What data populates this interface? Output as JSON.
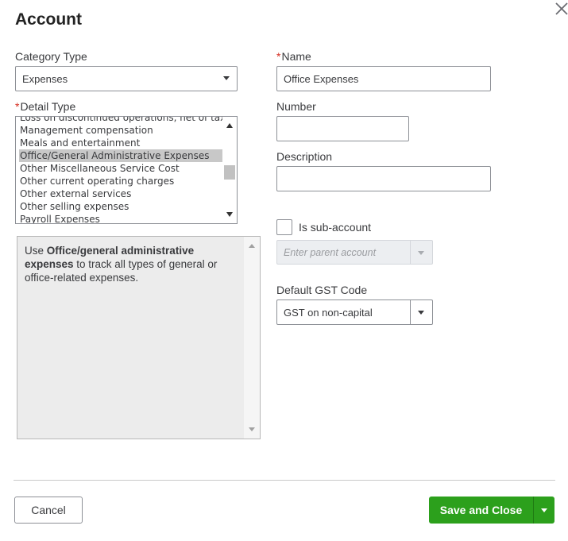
{
  "dialog": {
    "title": "Account"
  },
  "left": {
    "category_type_label": "Category Type",
    "category_type_value": "Expenses",
    "detail_type_label": "Detail Type",
    "detail_type_items": [
      "Loss on discontinued operations, net of tax",
      "Management compensation",
      "Meals and entertainment",
      "Office/General Administrative Expenses",
      "Other Miscellaneous Service Cost",
      "Other current operating charges",
      "Other external services",
      "Other selling expenses",
      "Payroll Expenses"
    ],
    "detail_type_selected": "Office/General Administrative Expenses",
    "description": {
      "prefix": "Use ",
      "bold": "Office/general administrative expenses",
      "suffix": " to track all types of general or office-related expenses."
    }
  },
  "right": {
    "name_label": "Name",
    "name_value": "Office Expenses",
    "number_label": "Number",
    "number_value": "",
    "description_label": "Description",
    "description_value": "",
    "subaccount_label": "Is sub-account",
    "subaccount_checked": false,
    "parent_placeholder": "Enter parent account",
    "gst_label": "Default GST Code",
    "gst_value": "GST on non-capital"
  },
  "footer": {
    "cancel_label": "Cancel",
    "save_label": "Save and Close"
  },
  "colors": {
    "primary_green": "#2ca01c",
    "required_red": "#d52b1e"
  },
  "icons": {
    "close": "close-icon",
    "dropdown": "chevron-down-icon"
  }
}
